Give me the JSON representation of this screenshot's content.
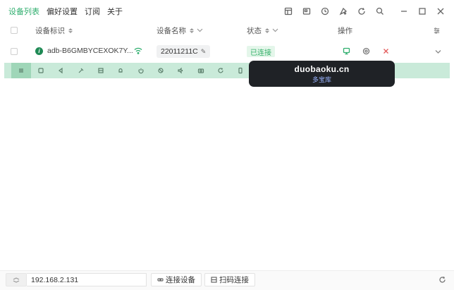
{
  "nav": {
    "items": [
      {
        "label": "设备列表",
        "active": true
      },
      {
        "label": "偏好设置",
        "active": false
      },
      {
        "label": "订阅",
        "active": false
      },
      {
        "label": "关于",
        "active": false
      }
    ]
  },
  "window_icons": [
    "layout-icon",
    "screen-icon",
    "history-icon",
    "theme-icon",
    "refresh-icon",
    "search-icon",
    "minimize-icon",
    "maximize-icon",
    "close-icon"
  ],
  "table": {
    "headers": {
      "device_id": "设备标识",
      "device_name": "设备名称",
      "status": "状态",
      "actions": "操作"
    },
    "rows": [
      {
        "device_id": "adb-B6GMBYCEXOK7Y...",
        "device_name": "22011211C",
        "status": "已连接"
      }
    ]
  },
  "toolbar_icons": [
    "menu-icon",
    "square-icon",
    "back-icon",
    "pin-icon",
    "save-icon",
    "bell-icon",
    "power-icon",
    "rotate-icon",
    "volume-icon",
    "camera-icon",
    "reload-icon",
    "phone-icon"
  ],
  "watermark": {
    "main": "duobaoku.cn",
    "sub": "多宝库"
  },
  "bottom": {
    "ip_value": "192.168.2.131",
    "connect_label": "连接设备",
    "scan_label": "扫码连接"
  },
  "colors": {
    "accent": "#2fae6e",
    "toolbar_bg": "#c9ead9",
    "status_bg": "#e4f6ea",
    "watermark_bg": "#1f2226"
  }
}
